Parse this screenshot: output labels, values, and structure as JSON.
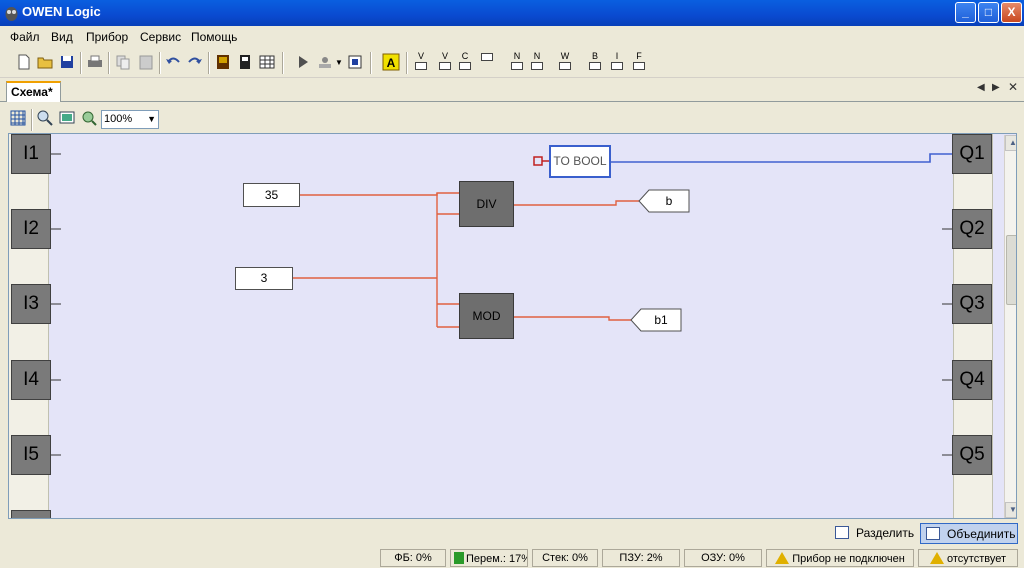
{
  "window": {
    "title": "OWEN Logic",
    "minimize": "_",
    "maximize": "□",
    "close": "X"
  },
  "menu": [
    "Файл",
    "Вид",
    "Прибор",
    "Сервис",
    "Помощь"
  ],
  "toolbar": {
    "icons": [
      "new-file-icon",
      "open-file-icon",
      "save-icon",
      "print-icon",
      "copy-icon",
      "paste-icon",
      "undo-icon",
      "redo-icon",
      "library-icon",
      "device-icon",
      "table-icon",
      "run-icon",
      "io-icon",
      "io-settings-icon",
      "text-icon"
    ],
    "var_buttons": [
      "V",
      "V",
      "C",
      "",
      "N",
      "N",
      "W",
      "B",
      "I",
      "F"
    ]
  },
  "tab": {
    "label": "Схема*"
  },
  "canvas_toolbar": {
    "zoom": "100%"
  },
  "inputs": [
    "I1",
    "I2",
    "I3",
    "I4",
    "I5"
  ],
  "outputs": [
    "Q1",
    "Q2",
    "Q3",
    "Q4",
    "Q5"
  ],
  "constants": [
    "35",
    "3"
  ],
  "blocks": [
    "DIV",
    "MOD",
    "TO BOOL"
  ],
  "output_vars": [
    "b",
    "b1"
  ],
  "colors": {
    "wire_red": "#e06040",
    "wire_blue": "#4060d0",
    "canvas_bg": "#e4e4f8",
    "block_gray": "#6e6e6e"
  },
  "split_bar": {
    "split": "Разделить",
    "join": "Объединить"
  },
  "status": {
    "fb": "ФБ: 0%",
    "vars": "Перем.: 17%",
    "stack": "Стек: 0%",
    "rom": "ПЗУ: 2%",
    "ram": "ОЗУ: 0%",
    "device": "Прибор не подключен",
    "absent": "отсутствует"
  }
}
